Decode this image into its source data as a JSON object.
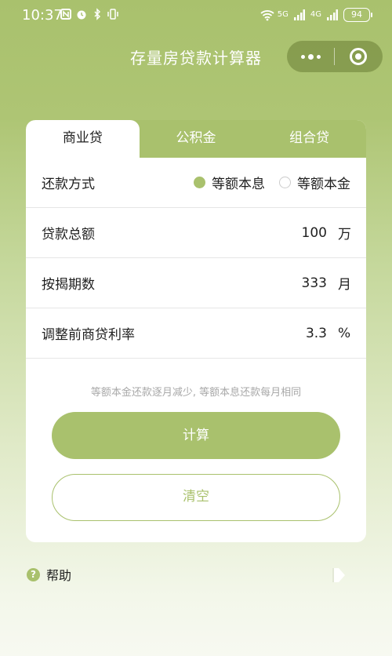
{
  "status_bar": {
    "time": "10:37",
    "net_1": "5G",
    "net_2": "4G",
    "battery": "94"
  },
  "header": {
    "title": "存量房贷款计算器"
  },
  "tabs": [
    {
      "label": "商业贷",
      "active": true
    },
    {
      "label": "公积金",
      "active": false
    },
    {
      "label": "组合贷",
      "active": false
    }
  ],
  "form": {
    "repay_method": {
      "label": "还款方式",
      "options": [
        {
          "label": "等额本息",
          "selected": true
        },
        {
          "label": "等额本金",
          "selected": false
        }
      ]
    },
    "loan_total": {
      "label": "贷款总额",
      "value": "100",
      "unit": "万"
    },
    "term": {
      "label": "按揭期数",
      "value": "333",
      "unit": "月"
    },
    "rate": {
      "label": "调整前商贷利率",
      "value": "3.3",
      "unit": "%"
    }
  },
  "hint": "等额本金还款逐月减少, 等额本息还款每月相同",
  "buttons": {
    "calculate": "计算",
    "clear": "清空"
  },
  "help": {
    "label": "帮助"
  },
  "colors": {
    "accent": "#a9c16d"
  }
}
